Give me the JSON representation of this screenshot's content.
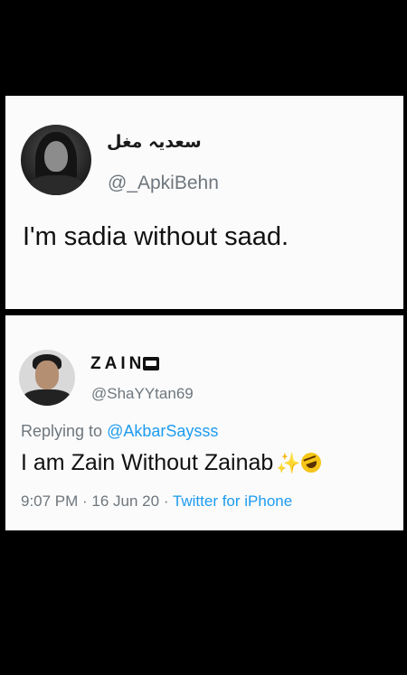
{
  "tweet1": {
    "display_name": "سعدیہ مغل",
    "handle": "@_ApkiBehn",
    "text": "I'm sadia without saad."
  },
  "tweet2": {
    "display_name": "ZAIN",
    "handle": "@ShaYYtan69",
    "replying_prefix": "Replying to ",
    "replying_to": "@AkbarSaysss",
    "text": "I am Zain Without Zainab",
    "emojis": [
      "sparkles-icon",
      "rolling-laughing-emoji"
    ],
    "time": "9:07 PM",
    "date": "16 Jun 20",
    "separator": " · ",
    "source": "Twitter for iPhone"
  },
  "colors": {
    "background": "#000000",
    "card": "#fbfbfb",
    "secondary_text": "#6e767d",
    "link": "#1d9bf0"
  }
}
